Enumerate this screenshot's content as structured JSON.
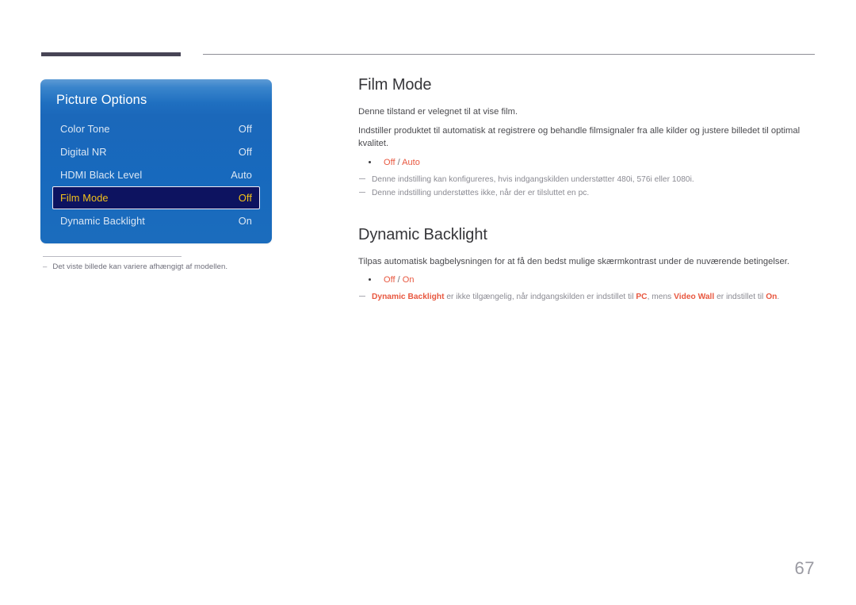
{
  "page": {
    "number": "67",
    "language": "da"
  },
  "osd": {
    "title": "Picture Options",
    "rows": [
      {
        "label": "Color Tone",
        "value": "Off",
        "selected": false
      },
      {
        "label": "Digital NR",
        "value": "Off",
        "selected": false
      },
      {
        "label": "HDMI Black Level",
        "value": "Auto",
        "selected": false
      },
      {
        "label": "Film Mode",
        "value": "Off",
        "selected": true
      },
      {
        "label": "Dynamic Backlight",
        "value": "On",
        "selected": false
      }
    ],
    "caption_dash": "–",
    "caption": "Det viste billede kan variere afhængigt af modellen."
  },
  "sections": [
    {
      "title": "Film Mode",
      "paragraphs": [
        "Denne tilstand er velegnet til at vise film.",
        "Indstiller produktet til automatisk at registrere og behandle filmsignaler fra alle kilder og justere billedet til optimal kvalitet."
      ],
      "options": [
        {
          "first": "Off",
          "sep": " / ",
          "second": "Auto"
        }
      ],
      "notes": [
        {
          "segments": [
            {
              "text": "Denne indstilling kan konfigureres, hvis indgangskilden understøtter 480i, 576i eller 1080i.",
              "highlight": false
            }
          ]
        },
        {
          "segments": [
            {
              "text": "Denne indstilling understøttes ikke, når der er tilsluttet en pc.",
              "highlight": false
            }
          ]
        }
      ]
    },
    {
      "title": "Dynamic Backlight",
      "paragraphs": [
        "Tilpas automatisk bagbelysningen for at få den bedst mulige skærmkontrast under de nuværende betingelser."
      ],
      "options": [
        {
          "first": "Off",
          "sep": " / ",
          "second": "On"
        }
      ],
      "notes": [
        {
          "segments": [
            {
              "text": "Dynamic Backlight",
              "highlight": true
            },
            {
              "text": " er ikke tilgængelig, når indgangskilden er indstillet til ",
              "highlight": false
            },
            {
              "text": "PC",
              "highlight": true
            },
            {
              "text": ", mens ",
              "highlight": false
            },
            {
              "text": "Video Wall",
              "highlight": true
            },
            {
              "text": " er indstillet til ",
              "highlight": false
            },
            {
              "text": "On",
              "highlight": true
            },
            {
              "text": ".",
              "highlight": false
            }
          ]
        }
      ]
    }
  ],
  "colors": {
    "accent_orange": "#e8573f",
    "osd_blue": "#1b6cbd",
    "osd_selected_bg": "#0d1360",
    "osd_selected_text": "#f2c21a",
    "header_bar": "#474455",
    "page_number": "#9a9aa2"
  }
}
